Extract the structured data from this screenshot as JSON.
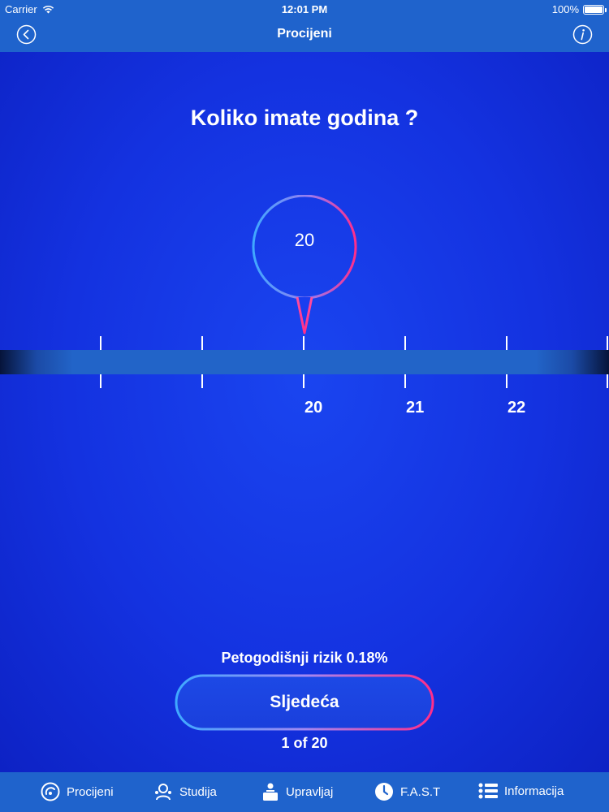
{
  "status_bar": {
    "carrier": "Carrier",
    "time": "12:01 PM",
    "battery": "100%"
  },
  "nav": {
    "title": "Procijeni",
    "back_icon": "chevron-left-icon",
    "info_icon": "info-icon"
  },
  "question": "Koliko imate godina ?",
  "selected_value": "20",
  "ruler": {
    "labels": [
      "20",
      "21",
      "22"
    ]
  },
  "risk_text": "Petogodišnji rizik 0.18%",
  "next_label": "Sljedeća",
  "progress_text": "1 of 20",
  "tabs": [
    {
      "label": "Procijeni",
      "icon": "gauge-icon"
    },
    {
      "label": "Studija",
      "icon": "study-icon"
    },
    {
      "label": "Upravljaj",
      "icon": "manage-icon"
    },
    {
      "label": "F.A.S.T",
      "icon": "clock-icon"
    },
    {
      "label": "Informacija",
      "icon": "list-icon"
    }
  ],
  "colors": {
    "bar": "#1f63cc",
    "accent_pink": "#ff2d8a",
    "accent_cyan": "#3fa9ff"
  }
}
